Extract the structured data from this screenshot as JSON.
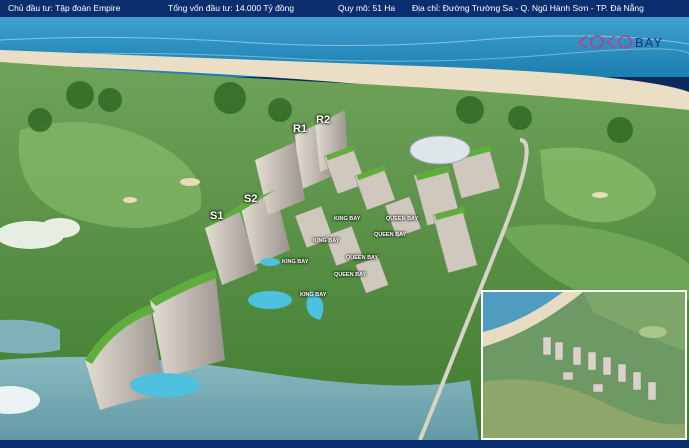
{
  "header": {
    "investor": "Chủ đầu tư: Tập đoàn Empire",
    "investment": "Tổng vốn đầu tư: 14.000 Tỷ đồng",
    "scale": "Quy mô: 51 Ha",
    "address": "Địa chỉ: Đường Trường Sa - Q. Ngũ Hành Sơn - TP. Đà Nẵng"
  },
  "brand": {
    "name": "COCOBAY",
    "color": "#c43a86"
  },
  "building_labels": {
    "r1": "R1",
    "r2": "R2",
    "s1": "S1",
    "s2": "S2"
  },
  "street_labels": {
    "a": "KING BAY",
    "b": "QUEEN BAY",
    "c": "KING BAY",
    "d": "QUEEN BAY",
    "e": "KING BAY",
    "f": "QUEEN BAY",
    "g": "QUEEN BAY",
    "h": "KING BAY"
  },
  "colors": {
    "header_bg": "#0b2f6e",
    "sea": "#1e86b8",
    "beach": "#e9dcc0",
    "greenery": "#4f8f3a",
    "building": "#c8c2ba",
    "rooftop": "#5fae3c",
    "river": "#7fb1b9"
  }
}
